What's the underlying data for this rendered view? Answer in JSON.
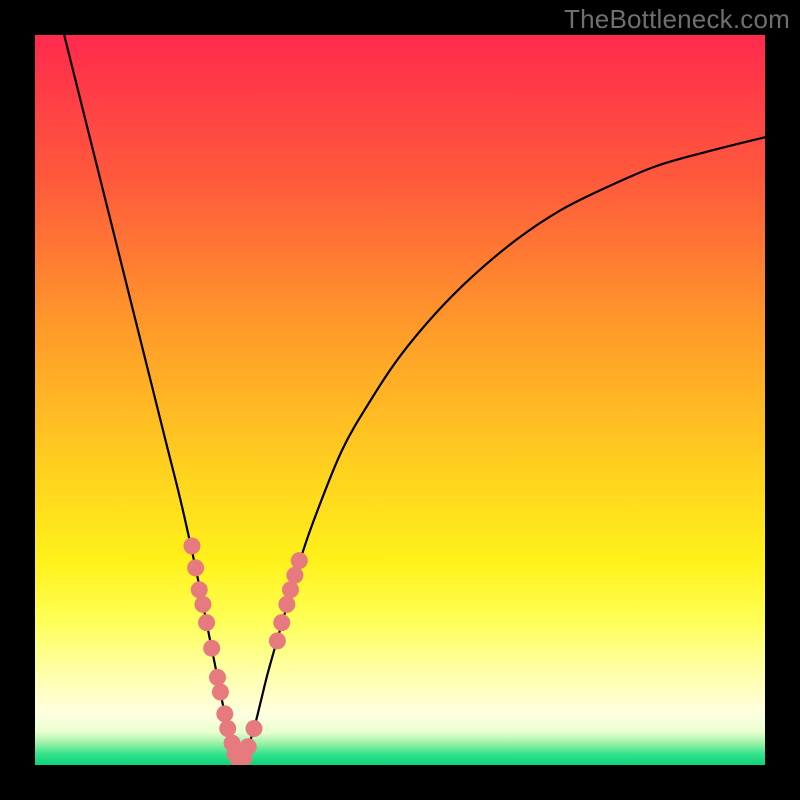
{
  "watermark": "TheBottleneck.com",
  "colors": {
    "background": "#000000",
    "curve": "#000000",
    "markers": "#e77a7e",
    "green_band": "#34e38c",
    "gradient_stops": [
      {
        "offset": 0.0,
        "color": "#ff2a4d"
      },
      {
        "offset": 0.2,
        "color": "#ff5a3c"
      },
      {
        "offset": 0.4,
        "color": "#ff9a2a"
      },
      {
        "offset": 0.6,
        "color": "#ffd21f"
      },
      {
        "offset": 0.72,
        "color": "#fff11a"
      },
      {
        "offset": 0.8,
        "color": "#ffff55"
      },
      {
        "offset": 0.88,
        "color": "#ffffb0"
      },
      {
        "offset": 0.93,
        "color": "#ffffe0"
      },
      {
        "offset": 0.955,
        "color": "#e9ffcf"
      },
      {
        "offset": 0.97,
        "color": "#9af2a7"
      },
      {
        "offset": 0.985,
        "color": "#34e38c"
      },
      {
        "offset": 1.0,
        "color": "#0dd27a"
      }
    ]
  },
  "chart_data": {
    "type": "line",
    "title": "",
    "xlabel": "",
    "ylabel": "",
    "xlim": [
      0,
      100
    ],
    "ylim": [
      0,
      100
    ],
    "series": [
      {
        "name": "bottleneck-curve",
        "x": [
          4,
          6,
          8,
          10,
          12,
          14,
          16,
          18,
          20,
          22,
          23,
          24,
          25,
          26,
          27,
          28,
          29,
          30,
          31,
          32,
          34,
          36,
          38,
          42,
          46,
          50,
          55,
          60,
          66,
          72,
          78,
          85,
          92,
          100
        ],
        "y": [
          100,
          92,
          84,
          76,
          68,
          60,
          52,
          44,
          36,
          27,
          22,
          17,
          12,
          7,
          3,
          0,
          2,
          5,
          9,
          13,
          20,
          27,
          33,
          43,
          50,
          56,
          62,
          67,
          72,
          76,
          79,
          82,
          84,
          86
        ]
      }
    ],
    "markers": [
      {
        "x": 21.5,
        "y": 30.0
      },
      {
        "x": 22.0,
        "y": 27.0
      },
      {
        "x": 22.5,
        "y": 24.0
      },
      {
        "x": 23.0,
        "y": 22.0
      },
      {
        "x": 23.5,
        "y": 19.5
      },
      {
        "x": 24.2,
        "y": 16.0
      },
      {
        "x": 25.0,
        "y": 12.0
      },
      {
        "x": 25.4,
        "y": 10.0
      },
      {
        "x": 26.0,
        "y": 7.0
      },
      {
        "x": 26.4,
        "y": 5.0
      },
      {
        "x": 27.0,
        "y": 3.0
      },
      {
        "x": 27.4,
        "y": 1.5
      },
      {
        "x": 28.0,
        "y": 0.5
      },
      {
        "x": 28.6,
        "y": 1.0
      },
      {
        "x": 29.2,
        "y": 2.5
      },
      {
        "x": 30.0,
        "y": 5.0
      },
      {
        "x": 33.2,
        "y": 17.0
      },
      {
        "x": 33.8,
        "y": 19.5
      },
      {
        "x": 34.5,
        "y": 22.0
      },
      {
        "x": 35.0,
        "y": 24.0
      },
      {
        "x": 35.6,
        "y": 26.0
      },
      {
        "x": 36.2,
        "y": 28.0
      }
    ]
  }
}
